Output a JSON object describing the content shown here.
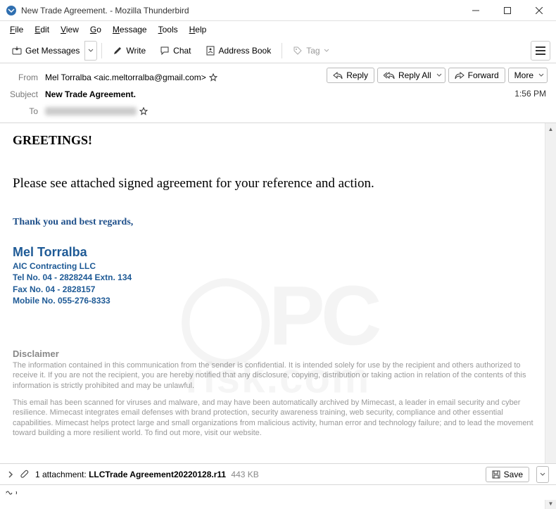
{
  "window": {
    "title": "New Trade Agreement. - Mozilla Thunderbird"
  },
  "menubar": [
    "File",
    "Edit",
    "View",
    "Go",
    "Message",
    "Tools",
    "Help"
  ],
  "toolbar": {
    "get_messages": "Get Messages",
    "write": "Write",
    "chat": "Chat",
    "address_book": "Address Book",
    "tag": "Tag"
  },
  "headers": {
    "from_label": "From",
    "from_value": "Mel Torralba <aic.meltorralba@gmail.com>",
    "subject_label": "Subject",
    "subject_value": "New Trade Agreement.",
    "to_label": "To",
    "time": "1:56 PM"
  },
  "actions": {
    "reply": "Reply",
    "reply_all": "Reply All",
    "forward": "Forward",
    "more": "More"
  },
  "body": {
    "greeting": "GREETINGS!",
    "line": "Please see attached signed agreement for your reference and action.",
    "thanks": "Thank you and best regards,",
    "sig_name": "Mel Torralba",
    "sig_company": "AIC Contracting LLC",
    "sig_tel": "Tel No.  04 - 2828244 Extn. 134",
    "sig_fax": "Fax No. 04 - 2828157",
    "sig_mobile": "Mobile No. 055-276-8333",
    "disclaimer_h": "Disclaimer",
    "disclaimer1": "The information contained in this communication from the sender is confidential. It is intended solely for use by the recipient and others authorized to receive it. If you are not the recipient, you are hereby notified that any disclosure, copying, distribution or taking action in relation of the contents of this information is strictly prohibited and may be unlawful.",
    "disclaimer2": "This email has been scanned for viruses and malware, and may have been automatically archived by Mimecast, a leader in email security and cyber resilience. Mimecast integrates email defenses with brand protection, security awareness training, web security, compliance and other essential capabilities. Mimecast helps protect large and small organizations from malicious activity, human error and technology failure; and to lead the movement toward building a more resilient world. To find out more, visit our website."
  },
  "attachment": {
    "count_label": "1 attachment:",
    "filename": "LLCTrade Agreement20220128.r11",
    "size": "443 KB",
    "save": "Save"
  }
}
